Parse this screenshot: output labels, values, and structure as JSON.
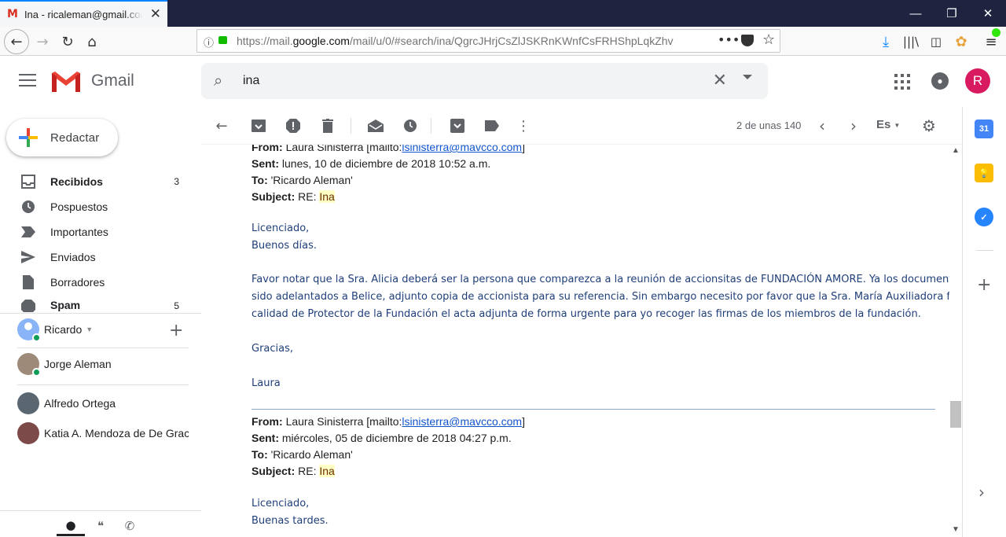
{
  "browser": {
    "tab_title": "Ina - ricaleman@gmail.com - Gmail",
    "url_prefix": "https://mail.",
    "url_domain": "google.com",
    "url_path": "/mail/u/0/#search/ina/QgrcJHrjCsZlJSKRnKWnfCsFRHShpLqkZhv",
    "colors": {
      "titlebar": "#202340",
      "accent": "#0a84ff"
    }
  },
  "gmail": {
    "product_name": "Gmail",
    "search_value": "ina",
    "avatar_letter": "R",
    "compose_label": "Redactar",
    "folders": [
      {
        "label": "Recibidos",
        "count": "3",
        "icon": "inbox-icon"
      },
      {
        "label": "Pospuestos",
        "count": "",
        "icon": "clock-icon"
      },
      {
        "label": "Importantes",
        "count": "",
        "icon": "important-icon"
      },
      {
        "label": "Enviados",
        "count": "",
        "icon": "send-icon"
      },
      {
        "label": "Borradores",
        "count": "",
        "icon": "draft-icon"
      },
      {
        "label": "Spam",
        "count": "5",
        "icon": "spam-icon"
      }
    ],
    "hangouts": {
      "me": "Ricardo",
      "contacts": [
        "Jorge Aleman",
        "Alfredo Ortega",
        "Katia A. Mendoza de De Gracia"
      ]
    },
    "pager": "2 de unas 140",
    "language": "Es"
  },
  "message": {
    "block1": {
      "from_label": "From:",
      "from_name": "Laura Sinisterra [mailto:",
      "from_email": "lsinisterra@mavcco.com",
      "from_close": "]",
      "sent_label": "Sent:",
      "sent_value": "lunes, 10 de diciembre de 2018 10:52 a.m.",
      "to_label": "To:",
      "to_value": "'Ricardo Aleman'",
      "subject_label": "Subject:",
      "subject_prefix": "RE: ",
      "subject_value": "Ina",
      "greeting1": "Licenciado,",
      "greeting2": "Buenos días.",
      "body_line1": "Favor notar que la Sra. Alicia deberá ser la persona que comparezca a la reunión de accionsitas de FUNDACIÓN AMORE.  Ya los documentos han",
      "body_line2": "sido adelantados a Belice, adjunto copia de accionista para su referencia.  Sin embargo necesito por favor que la Sra. María Auxiliadora firme en su",
      "body_line3": "calidad de Protector de la Fundación el acta adjunta de forma urgente para yo recoger las firmas de los miembros de la fundación.",
      "thanks": "Gracias,",
      "signature": "Laura"
    },
    "block2": {
      "from_label": "From:",
      "from_name": "Laura Sinisterra [mailto:",
      "from_email": "lsinisterra@mavcco.com",
      "from_close": "]",
      "sent_label": "Sent:",
      "sent_value": "miércoles, 05 de diciembre de 2018 04:27 p.m.",
      "to_label": "To:",
      "to_value": "'Ricardo Aleman'",
      "subject_label": "Subject:",
      "subject_prefix": "RE: ",
      "subject_value": "Ina",
      "greeting1": "Licenciado,",
      "greeting2": "Buenas tardes."
    }
  }
}
